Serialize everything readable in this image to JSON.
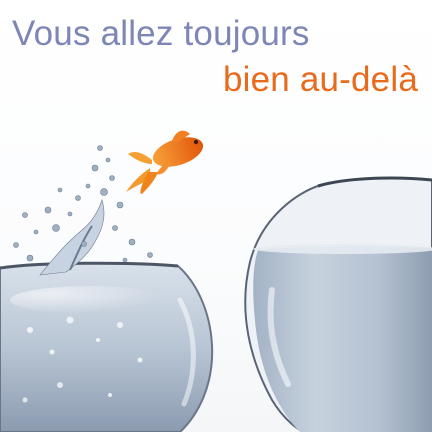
{
  "headline": {
    "line1": "Vous allez toujours",
    "line2": "bien au-delà",
    "line1_color": "#7d86b5",
    "line2_color": "#e86a1c"
  },
  "image": {
    "subject": "goldfish-jumping-between-bowls",
    "fish_color": "#f07a14",
    "water_color": "#b9c6d6"
  }
}
